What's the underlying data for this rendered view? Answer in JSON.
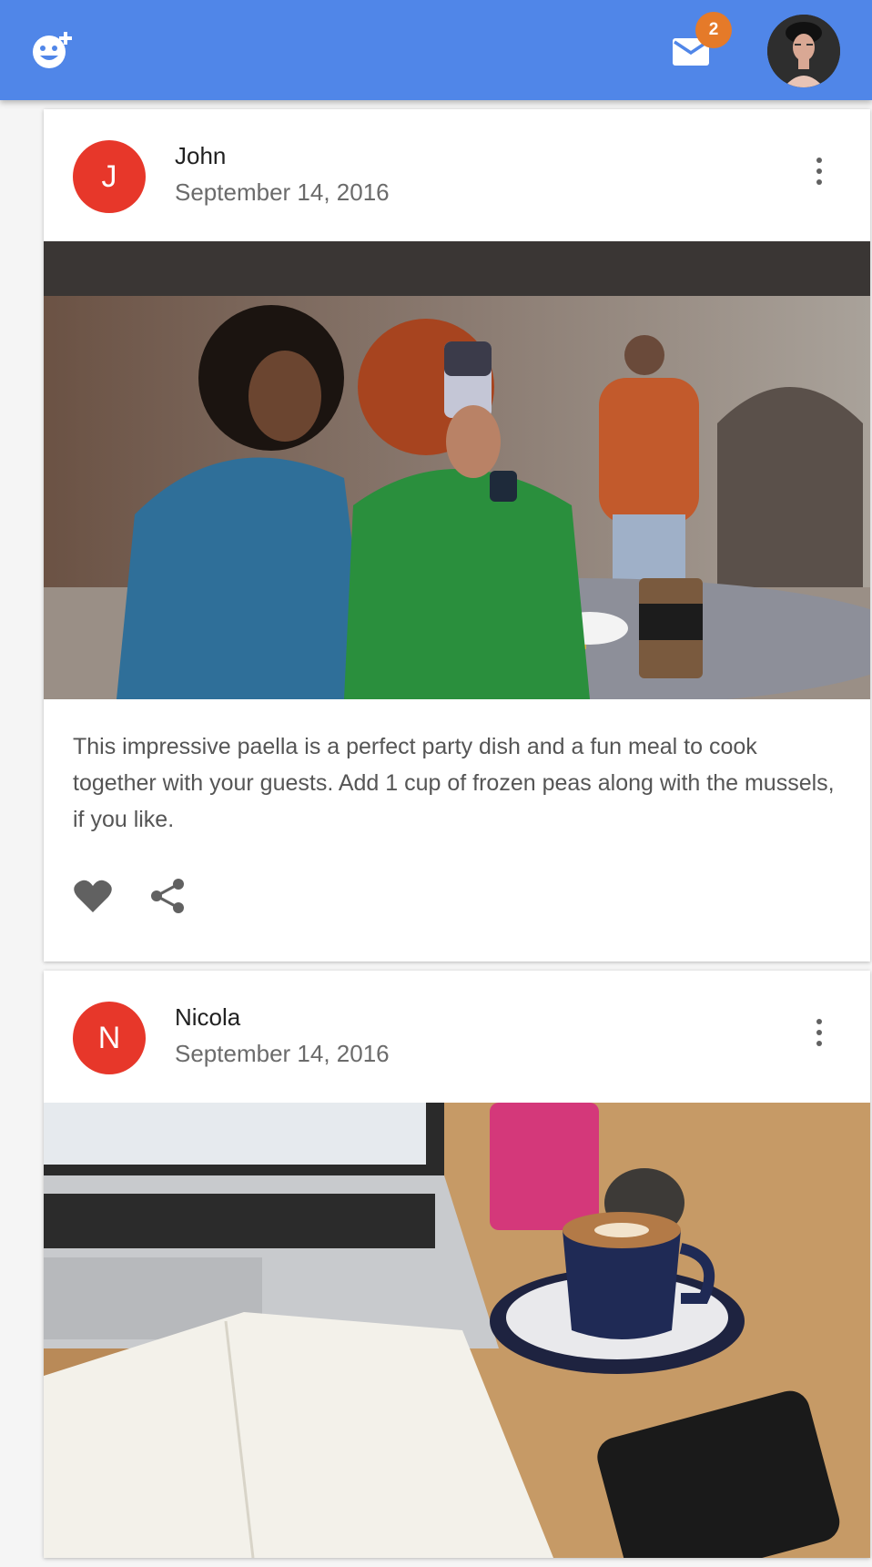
{
  "appbar": {
    "logo_icon": "add-reaction-icon",
    "mail_icon": "mail-icon",
    "mail_badge_count": "2",
    "profile_avatar": "user-profile-avatar",
    "colors": {
      "bar": "#5086e8",
      "badge": "#e57a29"
    }
  },
  "posts": [
    {
      "avatar_letter": "J",
      "author": "John",
      "date": "September 14, 2016",
      "image": "photo of two women taking a selfie at a cafe table",
      "text": "This impressive paella is a perfect party dish and a fun meal to cook together with your guests. Add 1 cup of frozen peas along with the mussels, if you like.",
      "actions": [
        "favorite-icon",
        "share-icon"
      ],
      "avatar_color": "#e7372a"
    },
    {
      "avatar_letter": "N",
      "author": "Nicola",
      "date": "September 14, 2016",
      "image": "photo of a laptop, coffee cup and open calendar on a wooden desk",
      "avatar_color": "#e7372a"
    }
  ]
}
